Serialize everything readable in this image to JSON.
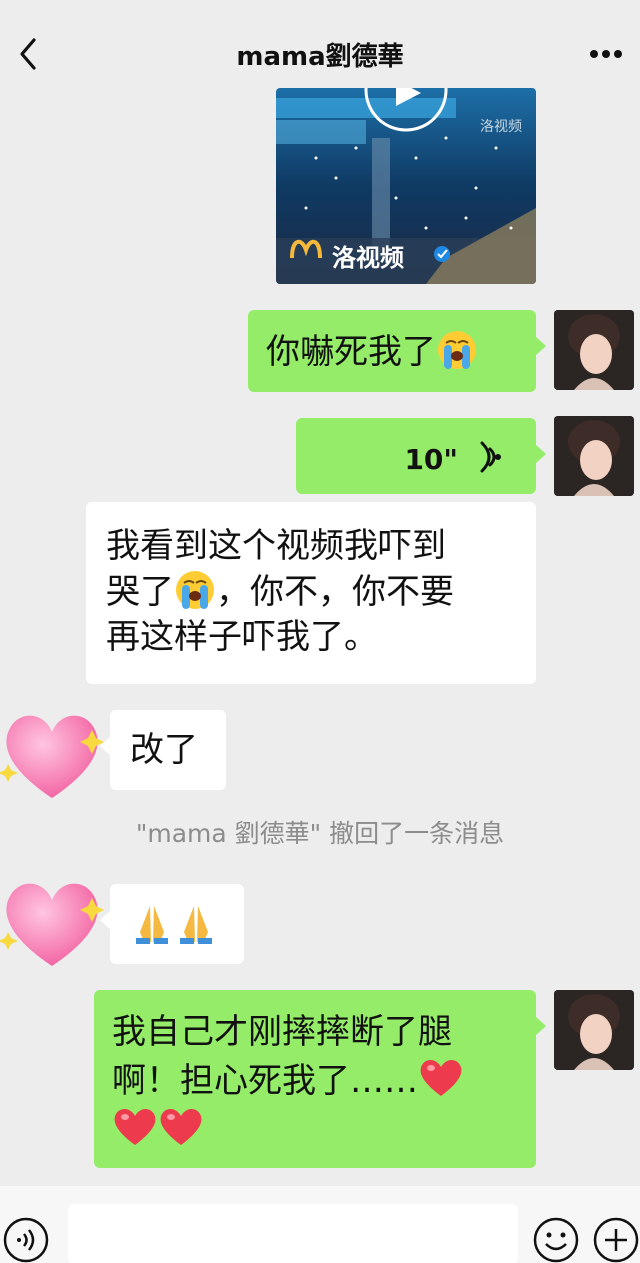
{
  "header": {
    "title": "mama劉德華"
  },
  "video": {
    "source": "洛视频",
    "watermark": "洛视频"
  },
  "messages": {
    "m1": "你嚇死我了",
    "voice_duration": "10\"",
    "m3_line1": "我看到这个视频我吓到",
    "m3_line2a": "哭了",
    "m3_line2b": "，你不，你不要",
    "m3_line3": "再这样子吓我了。",
    "m4": "改了",
    "m6_line1": "我自己才刚摔摔断了腿",
    "m6_line2": "啊！担心死我了……"
  },
  "system": {
    "recall_notice": "\"mama 劉德華\" 撤回了一条消息"
  },
  "icons": {
    "back": "chevron-left-icon",
    "more": "more-dots-icon",
    "play": "play-icon",
    "voice": "voice-wave-icon",
    "emoji_crying": "crying-face-icon",
    "emoji_heart": "red-heart-icon",
    "emoji_pray": "folded-hands-icon",
    "voice_toggle": "voice-input-icon",
    "sticker": "smiley-icon",
    "add": "plus-icon"
  },
  "colors": {
    "sent_bubble": "#95ec69",
    "received_bubble": "#ffffff",
    "background": "#ededed"
  }
}
